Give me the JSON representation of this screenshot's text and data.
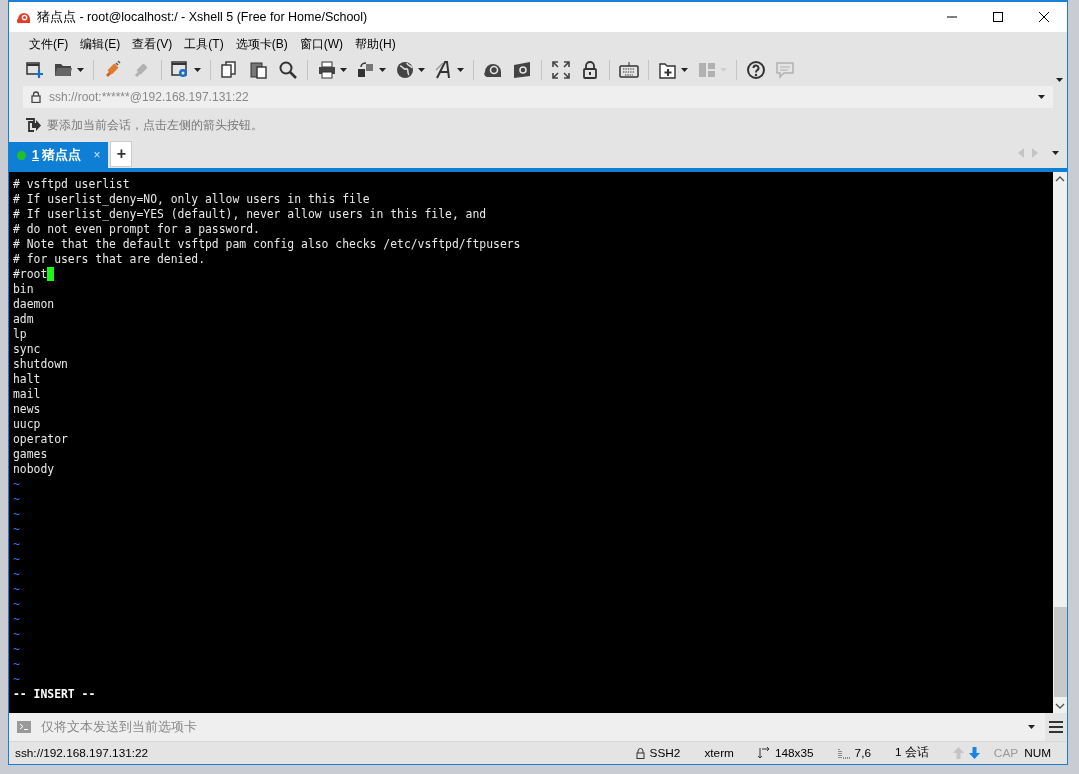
{
  "window": {
    "title": "猪点点 - root@localhost:/ - Xshell 5 (Free for Home/School)"
  },
  "menu": [
    "文件(F)",
    "编辑(E)",
    "查看(V)",
    "工具(T)",
    "选项卡(B)",
    "窗口(W)",
    "帮助(H)"
  ],
  "toolbar": [
    {
      "kind": "new",
      "disabled": false,
      "dropdown": false
    },
    {
      "kind": "open",
      "disabled": false,
      "dropdown": true
    },
    {
      "kind": "separator"
    },
    {
      "kind": "connect",
      "disabled": false,
      "dropdown": false
    },
    {
      "kind": "disconnect",
      "disabled": true,
      "dropdown": false
    },
    {
      "kind": "separator"
    },
    {
      "kind": "properties",
      "disabled": false,
      "dropdown": true
    },
    {
      "kind": "separator"
    },
    {
      "kind": "copy",
      "disabled": false,
      "dropdown": false
    },
    {
      "kind": "paste",
      "disabled": false,
      "dropdown": false
    },
    {
      "kind": "find",
      "disabled": false,
      "dropdown": false
    },
    {
      "kind": "separator"
    },
    {
      "kind": "print",
      "disabled": false,
      "dropdown": true
    },
    {
      "kind": "transfer",
      "disabled": false,
      "dropdown": true
    },
    {
      "kind": "globe",
      "disabled": false,
      "dropdown": true
    },
    {
      "kind": "font",
      "disabled": false,
      "dropdown": true
    },
    {
      "kind": "separator"
    },
    {
      "kind": "spiral",
      "disabled": false,
      "dropdown": false
    },
    {
      "kind": "window",
      "disabled": false,
      "dropdown": false
    },
    {
      "kind": "separator"
    },
    {
      "kind": "fullscreen",
      "disabled": false,
      "dropdown": false
    },
    {
      "kind": "lock",
      "disabled": false,
      "dropdown": false
    },
    {
      "kind": "separator"
    },
    {
      "kind": "keyboard",
      "disabled": false,
      "dropdown": false
    },
    {
      "kind": "separator"
    },
    {
      "kind": "add-tab",
      "disabled": false,
      "dropdown": true
    },
    {
      "kind": "layout",
      "disabled": true,
      "dropdown": true
    },
    {
      "kind": "separator"
    },
    {
      "kind": "help",
      "disabled": false,
      "dropdown": false
    },
    {
      "kind": "chat",
      "disabled": true,
      "dropdown": false
    }
  ],
  "address": {
    "value": "ssh://root:******@192.168.197.131:22"
  },
  "hint": "要添加当前会话，点击左侧的箭头按钮。",
  "tabs": [
    {
      "number": "1",
      "label": "猪点点",
      "selected": true,
      "connected": true,
      "close": "×"
    }
  ],
  "new_tab": "+",
  "terminal": {
    "lines": [
      {
        "kind": "text",
        "text": "# vsftpd userlist",
        "cursor": false
      },
      {
        "kind": "text",
        "text": "# If userlist_deny=NO, only allow users in this file",
        "cursor": false
      },
      {
        "kind": "text",
        "text": "# If userlist_deny=YES (default), never allow users in this file, and",
        "cursor": false
      },
      {
        "kind": "text",
        "text": "# do not even prompt for a password.",
        "cursor": false
      },
      {
        "kind": "text",
        "text": "# Note that the default vsftpd pam config also checks /etc/vsftpd/ftpusers",
        "cursor": false
      },
      {
        "kind": "text",
        "text": "# for users that are denied.",
        "cursor": false
      },
      {
        "kind": "text",
        "text": "#root",
        "cursor": true
      },
      {
        "kind": "text",
        "text": "bin",
        "cursor": false
      },
      {
        "kind": "text",
        "text": "daemon",
        "cursor": false
      },
      {
        "kind": "text",
        "text": "adm",
        "cursor": false
      },
      {
        "kind": "text",
        "text": "lp",
        "cursor": false
      },
      {
        "kind": "text",
        "text": "sync",
        "cursor": false
      },
      {
        "kind": "text",
        "text": "shutdown",
        "cursor": false
      },
      {
        "kind": "text",
        "text": "halt",
        "cursor": false
      },
      {
        "kind": "text",
        "text": "mail",
        "cursor": false
      },
      {
        "kind": "text",
        "text": "news",
        "cursor": false
      },
      {
        "kind": "text",
        "text": "uucp",
        "cursor": false
      },
      {
        "kind": "text",
        "text": "operator",
        "cursor": false
      },
      {
        "kind": "text",
        "text": "games",
        "cursor": false
      },
      {
        "kind": "text",
        "text": "nobody",
        "cursor": false
      },
      {
        "kind": "tilde",
        "text": "~",
        "cursor": false
      },
      {
        "kind": "tilde",
        "text": "~",
        "cursor": false
      },
      {
        "kind": "tilde",
        "text": "~",
        "cursor": false
      },
      {
        "kind": "tilde",
        "text": "~",
        "cursor": false
      },
      {
        "kind": "tilde",
        "text": "~",
        "cursor": false
      },
      {
        "kind": "tilde",
        "text": "~",
        "cursor": false
      },
      {
        "kind": "tilde",
        "text": "~",
        "cursor": false
      },
      {
        "kind": "tilde",
        "text": "~",
        "cursor": false
      },
      {
        "kind": "tilde",
        "text": "~",
        "cursor": false
      },
      {
        "kind": "tilde",
        "text": "~",
        "cursor": false
      },
      {
        "kind": "tilde",
        "text": "~",
        "cursor": false
      },
      {
        "kind": "tilde",
        "text": "~",
        "cursor": false
      },
      {
        "kind": "tilde",
        "text": "~",
        "cursor": false
      },
      {
        "kind": "tilde",
        "text": "~",
        "cursor": false
      },
      {
        "kind": "mode",
        "text": "-- INSERT --",
        "cursor": false
      }
    ]
  },
  "compose": {
    "placeholder": "仅将文本发送到当前选项卡"
  },
  "status_bar": {
    "address": "ssh://192.168.197.131:22",
    "items": [
      {
        "kind": "protocol",
        "text": "SSH2"
      },
      {
        "kind": "plain",
        "text": "xterm"
      },
      {
        "kind": "size",
        "text": "148x35"
      },
      {
        "kind": "position",
        "text": "7,6"
      },
      {
        "kind": "plain",
        "text": "1 会话"
      }
    ],
    "transfer": [
      {
        "kind": "up",
        "active": false
      },
      {
        "kind": "down",
        "active": true
      }
    ],
    "keys": [
      {
        "label": "CAP",
        "on": false
      },
      {
        "label": "NUM",
        "on": true
      }
    ]
  }
}
